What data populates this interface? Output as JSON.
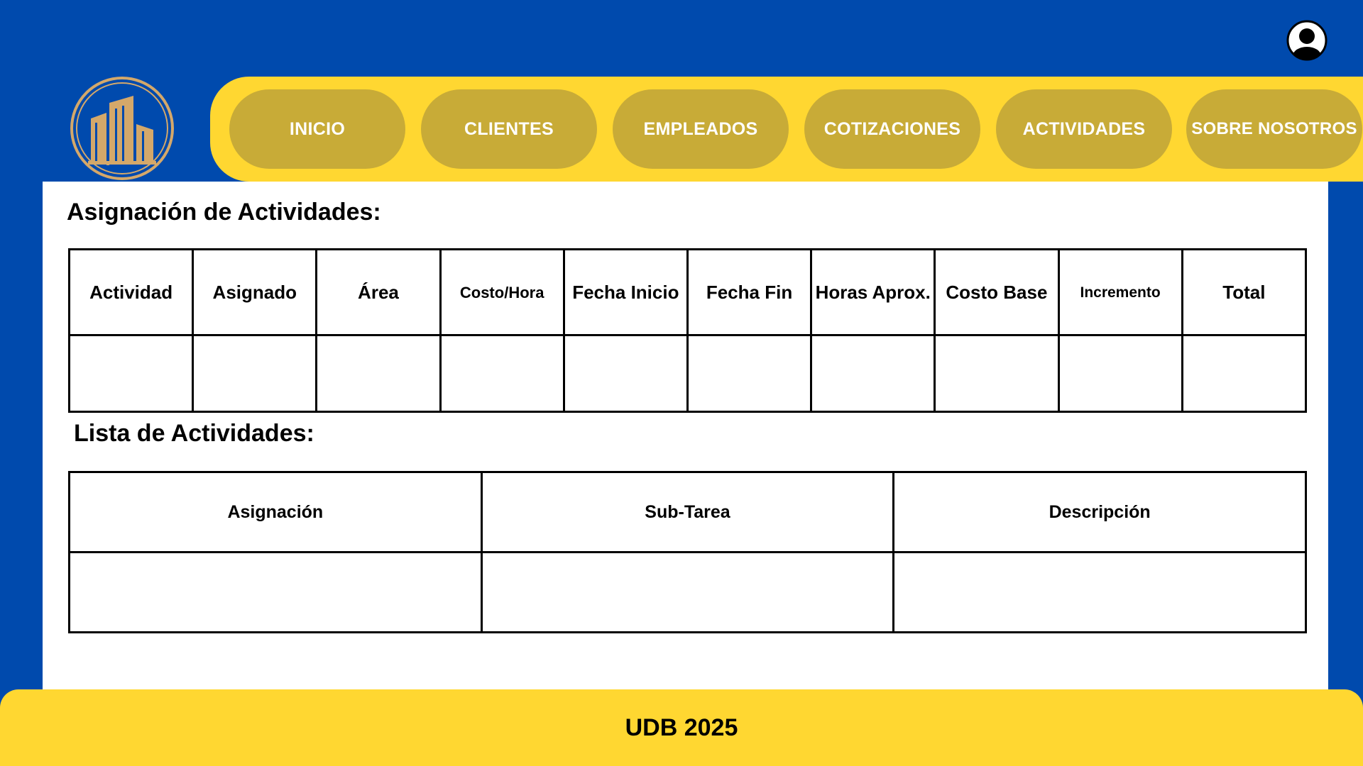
{
  "nav": {
    "items": [
      {
        "label": "INICIO"
      },
      {
        "label": "CLIENTES"
      },
      {
        "label": "EMPLEADOS"
      },
      {
        "label": "COTIZACIONES"
      },
      {
        "label": "ACTIVIDADES"
      },
      {
        "label": "SOBRE NOSOTROS"
      }
    ]
  },
  "icons": {
    "avatar": "user-avatar-icon",
    "logo": "building-logo"
  },
  "colors": {
    "background": "#004aad",
    "nav_bar": "#ffd731",
    "nav_button": "#c8ab37",
    "logo_gold": "#d4a86a",
    "panel": "#ffffff"
  },
  "assignment": {
    "title": "Asignación de Actividades:",
    "headers": [
      "Actividad",
      "Asignado",
      "Área",
      "Costo/Hora",
      "Fecha Inicio",
      "Fecha Fin",
      "Horas Aprox.",
      "Costo Base",
      "Incremento",
      "Total"
    ],
    "rows": [
      [
        "",
        "",
        "",
        "",
        "",
        "",
        "",
        "",
        "",
        ""
      ]
    ]
  },
  "activity_list": {
    "title": "Lista de Actividades:",
    "headers": [
      "Asignación",
      "Sub-Tarea",
      "Descripción"
    ],
    "rows": [
      [
        "",
        "",
        ""
      ]
    ]
  },
  "footer": {
    "text": "UDB 2025"
  }
}
